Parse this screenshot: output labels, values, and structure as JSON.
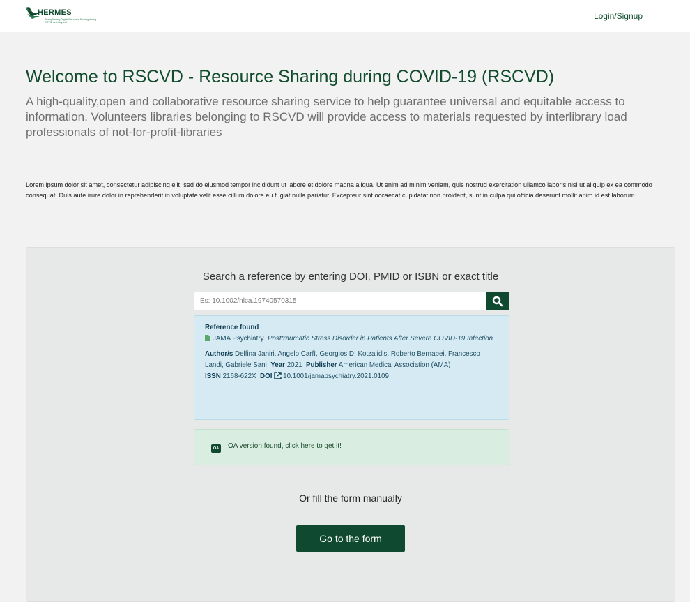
{
  "header": {
    "logo_text": "HERMES",
    "logo_tagline": "Strengthening Digital Resource Sharing during COVID and Beyond",
    "login_label": "Login/Signup"
  },
  "hero": {
    "title": "Welcome to RSCVD - Resource Sharing during COVID-19 (RSCVD)",
    "subtitle": "A high-quality,open and collaborative resource sharing service to help guarantee universal and equitable access to information. Volunteers libraries belonging to RSCVD will provide access to materials requested by interlibrary load professionals of not-for-profit-libraries",
    "lorem": "Lorem ipsum dolor sit amet, consectetur adipiscing elit, sed do eiusmod tempor incididunt ut labore et dolore magna aliqua. Ut enim ad minim veniam, quis nostrud exercitation ullamco laboris nisi ut aliquip ex ea commodo consequat. Duis aute irure dolor in reprehenderit in voluptate velit esse cillum dolore eu fugiat nulla pariatur. Excepteur sint occaecat cupidatat non proident, sunt in culpa qui officia deserunt mollit anim id est laborum"
  },
  "search": {
    "label": "Search a reference by entering DOI, PMID or ISBN or exact title",
    "placeholder": "Es: 10.1002/hlca.19740570315",
    "button_icon": "search-icon"
  },
  "reference": {
    "heading": "Reference found",
    "journal": "JAMA Psychiatry",
    "article_title": "Posttraumatic Stress Disorder in Patients After Severe COVID-19 Infection",
    "authors_label": "Author/s",
    "authors": "Delfina Janiri, Angelo Carfì, Georgios D. Kotzalidis, Roberto Bernabei, Francesco Landi, Gabriele Sani",
    "year_label": "Year",
    "year": "2021",
    "publisher_label": "Publisher",
    "publisher": "American Medical Association (AMA)",
    "issn_label": "ISSN",
    "issn": "2168-622X",
    "doi_label": "DOI",
    "doi": "10.1001/jamapsychiatry.2021.0109"
  },
  "oa": {
    "badge": "OA",
    "text": "OA version found, click here to get it!"
  },
  "manual": {
    "label": "Or fill the form manually",
    "button_label": "Go to the form"
  },
  "colors": {
    "brand_green": "#0f4a30",
    "info_blue": "#d6eaf3",
    "success_green": "#d9eee0"
  }
}
